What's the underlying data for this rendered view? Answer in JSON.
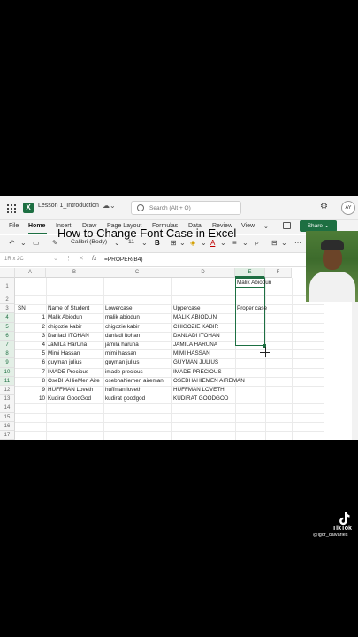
{
  "window": {
    "app_logo": "X",
    "doc_title": "Lesson 1_Introduction",
    "search_placeholder": "Search (Alt + Q)",
    "avatar_initials": "AY"
  },
  "ribbon": {
    "tabs": [
      {
        "label": "File"
      },
      {
        "label": "Home"
      },
      {
        "label": "Insert"
      },
      {
        "label": "Draw"
      },
      {
        "label": "Page Layout"
      },
      {
        "label": "Formulas"
      },
      {
        "label": "Data"
      },
      {
        "label": "Review"
      },
      {
        "label": "View"
      }
    ],
    "share_label": "Share",
    "more_glyph": "⌄"
  },
  "toolbar": {
    "font_name": "Calibri (Body)",
    "font_size": "11",
    "bold": "B"
  },
  "formula_bar": {
    "name_box": "1R x 2C",
    "fx": "fx",
    "formula": "=PROPER(B4)"
  },
  "sheet": {
    "columns": [
      "A",
      "B",
      "C",
      "D",
      "E",
      "F"
    ],
    "rows": [
      "1",
      "2",
      "3",
      "4",
      "5",
      "6",
      "7",
      "8",
      "9",
      "10",
      "11",
      "12",
      "13",
      "14",
      "15",
      "16",
      "17"
    ],
    "title": "How to Change Font Case in Excel",
    "headers": {
      "sn": "SN",
      "name": "Name of Student",
      "lower": "Lowercase",
      "upper": "Uppercase",
      "proper": "Proper case"
    },
    "data_rows": [
      {
        "sn": "1",
        "name": "Malik Abiodun",
        "lower": "malik abiodun",
        "upper": "MALIK ABIODUN",
        "proper": "Malik Abiodun"
      },
      {
        "sn": "2",
        "name": "chigozie kabir",
        "lower": "chigozie kabir",
        "upper": "CHIGOZIE KABIR",
        "proper": ""
      },
      {
        "sn": "3",
        "name": "Danladi ITOHAN",
        "lower": "danladi itohan",
        "upper": "DANLADI ITOHAN",
        "proper": ""
      },
      {
        "sn": "4",
        "name": "JaMILa HarUna",
        "lower": "jamila haruna",
        "upper": "JAMILA HARUNA",
        "proper": ""
      },
      {
        "sn": "5",
        "name": "Mimi Hassan",
        "lower": "mimi hassan",
        "upper": "MIMI HASSAN",
        "proper": ""
      },
      {
        "sn": "6",
        "name": "guyman julius",
        "lower": "guyman julius",
        "upper": "GUYMAN JULIUS",
        "proper": ""
      },
      {
        "sn": "7",
        "name": "IMADE Precious",
        "lower": "imade precious",
        "upper": "IMADE PRECIOUS",
        "proper": ""
      },
      {
        "sn": "8",
        "name": "OseBHAHieMen Aire",
        "lower": "osebhahiemen aireman",
        "upper": "OSEBHAHIEMEN AIREMAN",
        "proper": ""
      },
      {
        "sn": "9",
        "name": "HUFFMAN Loveth",
        "lower": "huffman loveth",
        "upper": "HUFFMAN LOVETH",
        "proper": ""
      },
      {
        "sn": "10",
        "name": "Kudirat GoodGod",
        "lower": "kudirat goodgod",
        "upper": "KUDIRAT GOODGOD",
        "proper": ""
      }
    ]
  },
  "watermark": {
    "brand": "TikTok",
    "user": "@igor_calvaries"
  },
  "colors": {
    "excel_green": "#1d6f42",
    "background": "#000000"
  }
}
